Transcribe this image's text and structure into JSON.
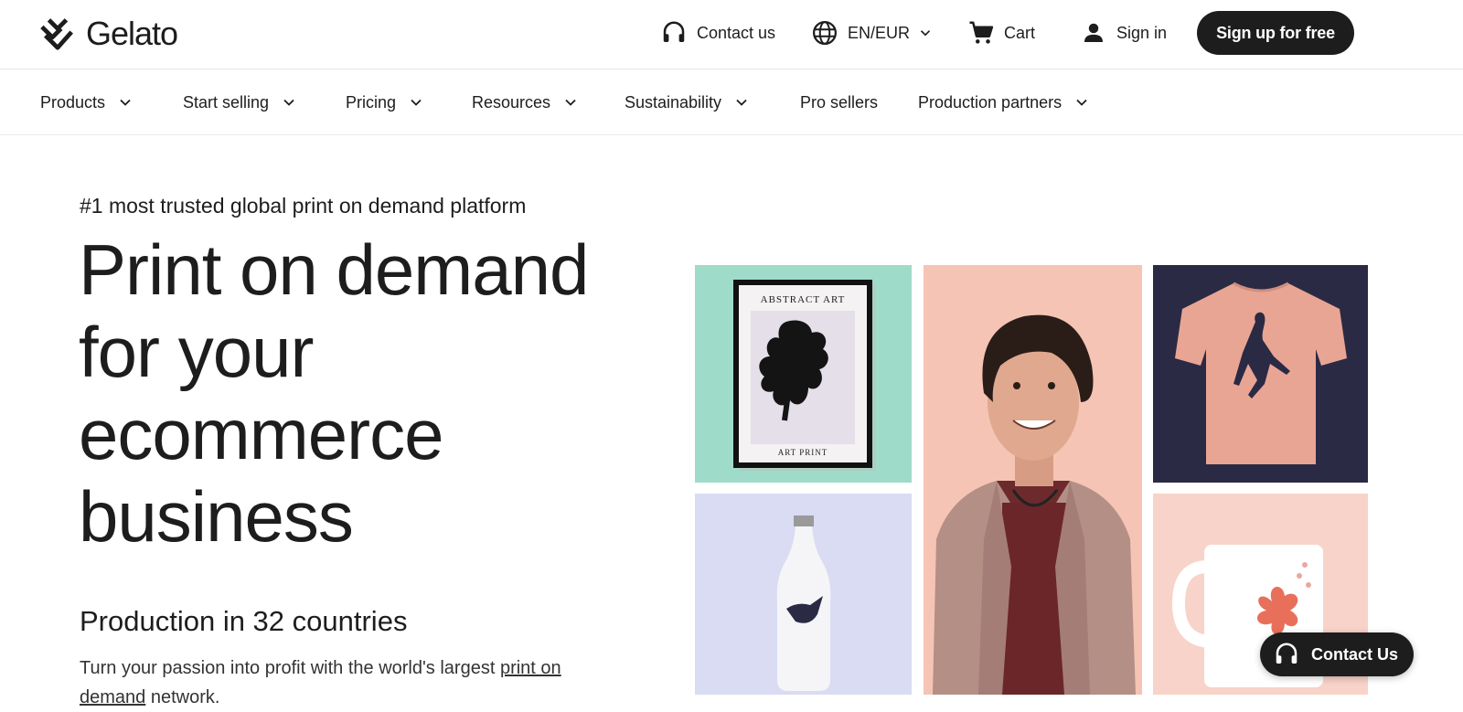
{
  "brand": {
    "name": "Gelato"
  },
  "topbar": {
    "contact_label": "Contact us",
    "locale_label": "EN/EUR",
    "cart_label": "Cart",
    "signin_label": "Sign in",
    "signup_label": "Sign up for free"
  },
  "nav": {
    "items": [
      {
        "label": "Products",
        "has_dropdown": true
      },
      {
        "label": "Start selling",
        "has_dropdown": true
      },
      {
        "label": "Pricing",
        "has_dropdown": true
      },
      {
        "label": "Resources",
        "has_dropdown": true
      },
      {
        "label": "Sustainability",
        "has_dropdown": true
      },
      {
        "label": "Pro sellers",
        "has_dropdown": false
      },
      {
        "label": "Production partners",
        "has_dropdown": true
      }
    ]
  },
  "hero": {
    "eyebrow": "#1 most trusted global print on demand platform",
    "headline_lines": [
      "Print on demand",
      "for your",
      "ecommerce",
      "business"
    ],
    "subhead": "Production in 32 countries",
    "description_before": "Turn your passion into profit with the world's largest ",
    "description_link": "print on demand",
    "description_after": " network."
  },
  "gallery": {
    "art_print_top": "ABSTRACT ART",
    "art_print_bottom": "ART PRINT",
    "colors": {
      "mint": "#9edbc8",
      "peach": "#f5c4b4",
      "navy": "#2b2a45",
      "lavender": "#d9dcf3",
      "blush": "#f8d3c9",
      "tee": "#e9a593",
      "flower": "#e8705a"
    }
  },
  "floating_contact": {
    "label": "Contact Us"
  },
  "colors": {
    "text": "#1d1d1d",
    "button_bg": "#1d1d1d",
    "button_text": "#ffffff",
    "divider": "#e6e6e6"
  }
}
